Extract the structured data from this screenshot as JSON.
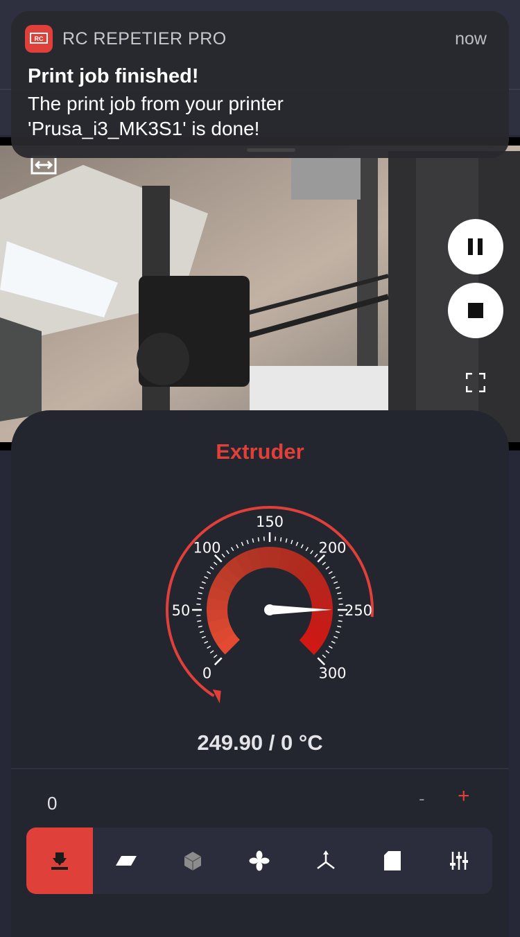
{
  "notification": {
    "app_name": "RC REPETIER PRO",
    "time": "now",
    "title": "Print job finished!",
    "body": "The print job from your printer 'Prusa_i3_MK3S1' is done!"
  },
  "camera": {
    "pause_icon": "pause-icon",
    "stop_icon": "stop-icon",
    "fullscreen_icon": "fullscreen-icon",
    "swap_icon": "swap-horizontal-icon"
  },
  "panel": {
    "title": "Extruder",
    "gauge": {
      "min": 0,
      "max": 300,
      "major_ticks": [
        "0",
        "50",
        "100",
        "150",
        "200",
        "250",
        "300"
      ],
      "current_value": 249.9,
      "target_value": 0,
      "accent": "#e0403a"
    },
    "readout": "249.90 /  0 °C",
    "speed_value": "0",
    "minus_label": "-",
    "plus_label": "+"
  },
  "tabs": [
    {
      "name": "extruder",
      "icon": "extruder-icon",
      "active": true
    },
    {
      "name": "bed",
      "icon": "heatbed-icon",
      "active": false
    },
    {
      "name": "chamber",
      "icon": "cube-icon",
      "active": false
    },
    {
      "name": "fan",
      "icon": "fan-icon",
      "active": false
    },
    {
      "name": "move",
      "icon": "axes-icon",
      "active": false
    },
    {
      "name": "sd-card",
      "icon": "sd-card-icon",
      "active": false
    },
    {
      "name": "settings",
      "icon": "sliders-icon",
      "active": false
    }
  ]
}
